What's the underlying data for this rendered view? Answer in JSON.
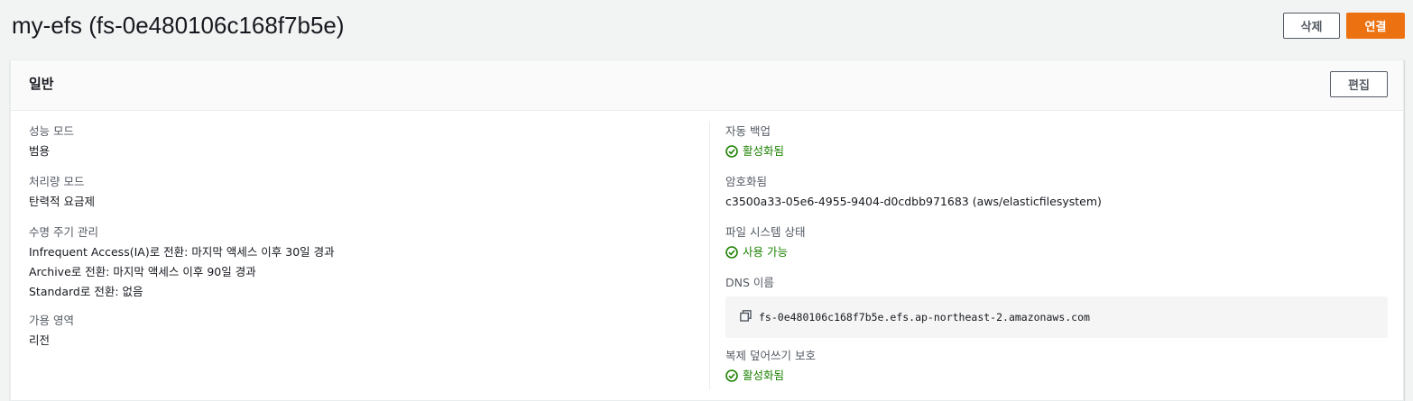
{
  "header": {
    "title": "my-efs (fs-0e480106c168f7b5e)",
    "delete_label": "삭제",
    "connect_label": "연결"
  },
  "panel": {
    "title": "일반",
    "edit_label": "편집",
    "left": {
      "performance_mode": {
        "label": "성능 모드",
        "value": "범용"
      },
      "throughput_mode": {
        "label": "처리량 모드",
        "value": "탄력적 요금제"
      },
      "lifecycle": {
        "label": "수명 주기 관리",
        "lines": [
          "Infrequent Access(IA)로 전환: 마지막 액세스 이후 30일 경과",
          "Archive로 전환: 마지막 액세스 이후 90일 경과",
          "Standard로 전환: 없음"
        ]
      },
      "availability_zone": {
        "label": "가용 영역",
        "value": "리전"
      }
    },
    "right": {
      "auto_backup": {
        "label": "자동 백업",
        "value": "활성화됨"
      },
      "encryption": {
        "label": "암호화됨",
        "value": "c3500a33-05e6-4955-9404-d0cdbb971683 (aws/elasticfilesystem)"
      },
      "fs_state": {
        "label": "파일 시스템 상태",
        "value": "사용 가능"
      },
      "dns": {
        "label": "DNS 이름",
        "value": "fs-0e480106c168f7b5e.efs.ap-northeast-2.amazonaws.com"
      },
      "replication_overwrite": {
        "label": "복제 덮어쓰기 보호",
        "value": "활성화됨"
      }
    }
  },
  "colors": {
    "success": "#1d8102",
    "primary": "#ec7211",
    "background": "#f2f3f3"
  },
  "icons": {
    "status": "status-positive-icon",
    "copy": "copy-icon"
  }
}
